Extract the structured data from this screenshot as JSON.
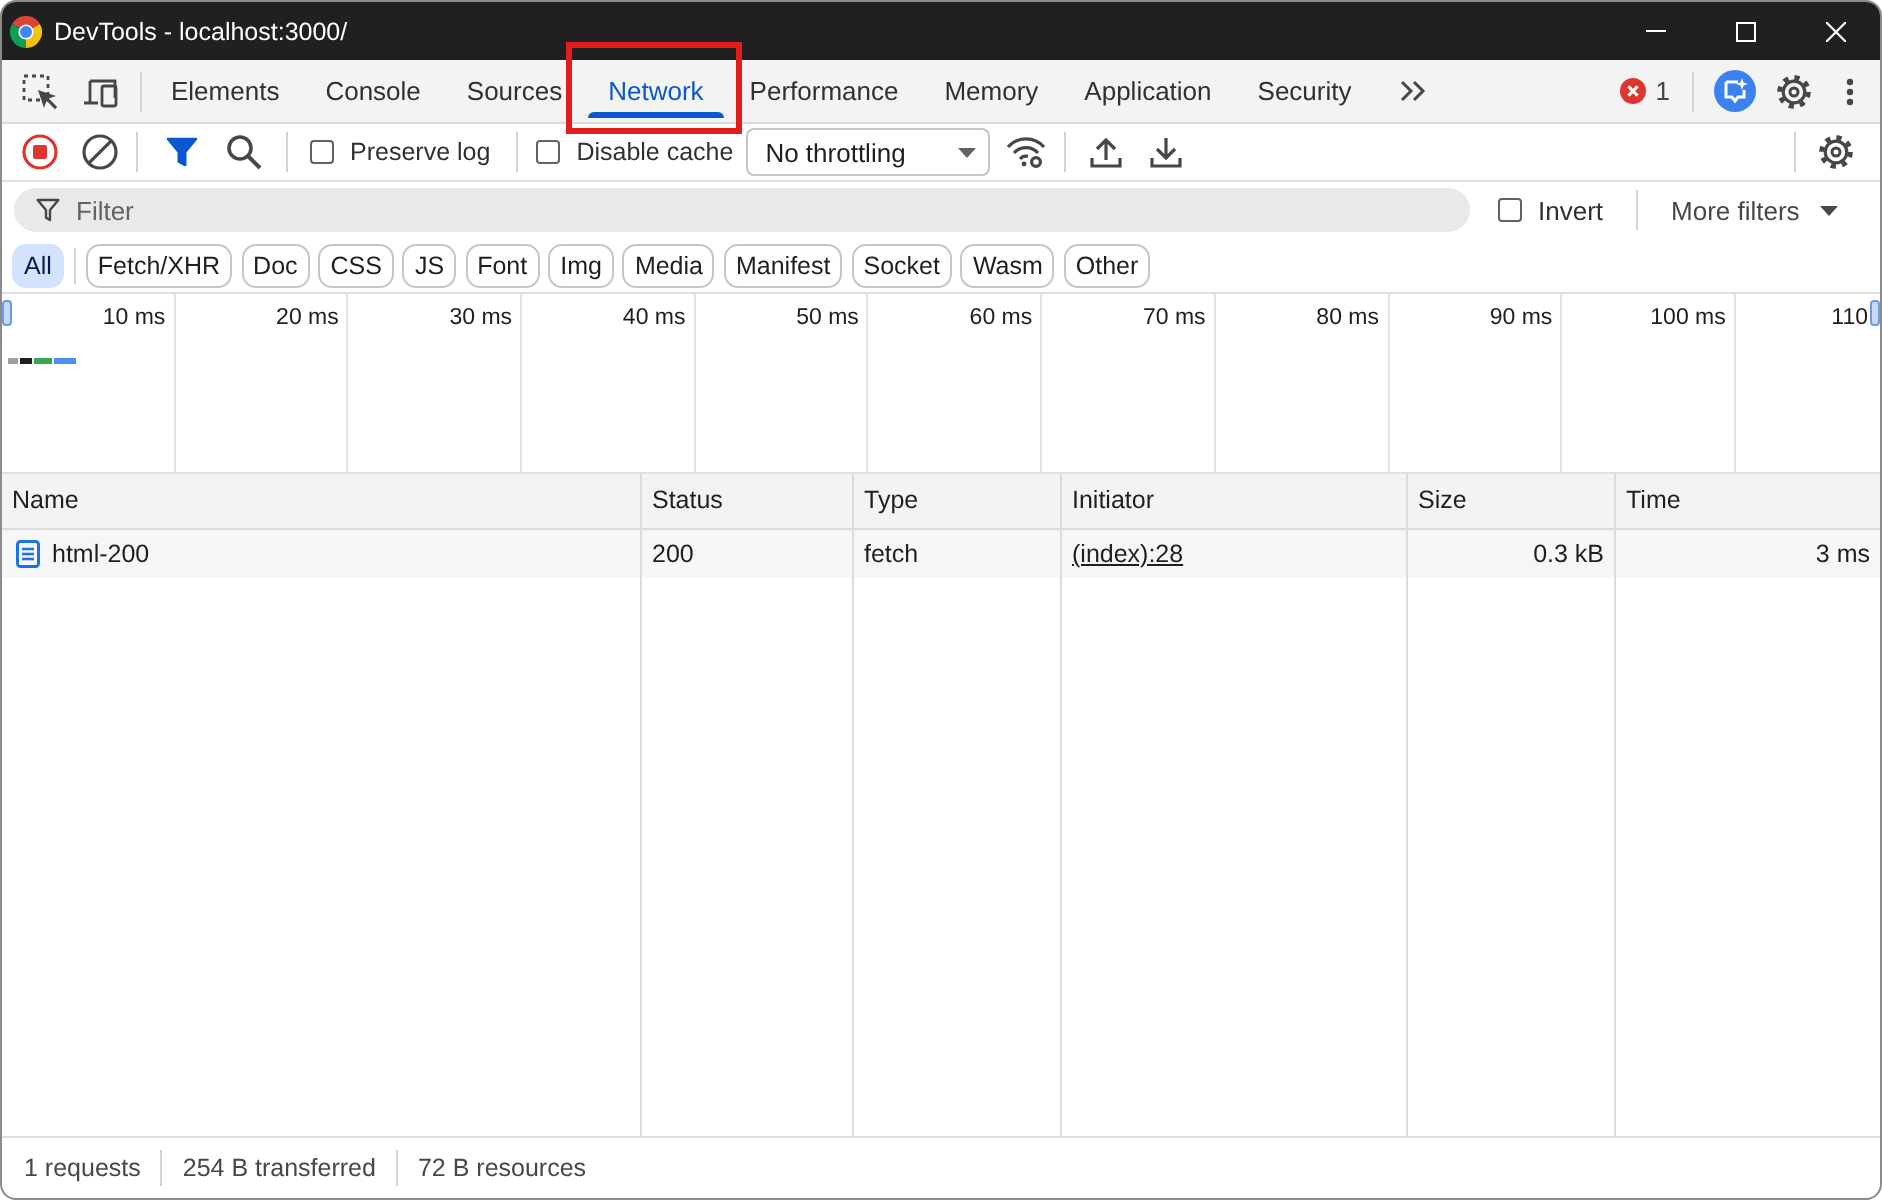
{
  "window": {
    "title": "DevTools - localhost:3000/"
  },
  "tabs": [
    {
      "label": "Elements",
      "selected": false,
      "highlighted": false
    },
    {
      "label": "Console",
      "selected": false,
      "highlighted": false
    },
    {
      "label": "Sources",
      "selected": false,
      "highlighted": false
    },
    {
      "label": "Network",
      "selected": true,
      "highlighted": true
    },
    {
      "label": "Performance",
      "selected": false,
      "highlighted": false
    },
    {
      "label": "Memory",
      "selected": false,
      "highlighted": false
    },
    {
      "label": "Application",
      "selected": false,
      "highlighted": false
    },
    {
      "label": "Security",
      "selected": false,
      "highlighted": false
    }
  ],
  "issues": {
    "error_count": "1"
  },
  "toolbar": {
    "recording": true,
    "filter_active": true,
    "preserve_log": {
      "label": "Preserve log",
      "checked": false
    },
    "disable_cache": {
      "label": "Disable cache",
      "checked": false
    },
    "throttling": "No throttling"
  },
  "filter": {
    "placeholder": "Filter",
    "invert": {
      "label": "Invert",
      "checked": false
    },
    "more_filters": "More filters"
  },
  "type_filters": [
    {
      "label": "All",
      "selected": true
    },
    {
      "label": "Fetch/XHR",
      "selected": false
    },
    {
      "label": "Doc",
      "selected": false
    },
    {
      "label": "CSS",
      "selected": false
    },
    {
      "label": "JS",
      "selected": false
    },
    {
      "label": "Font",
      "selected": false
    },
    {
      "label": "Img",
      "selected": false
    },
    {
      "label": "Media",
      "selected": false
    },
    {
      "label": "Manifest",
      "selected": false
    },
    {
      "label": "Socket",
      "selected": false
    },
    {
      "label": "Wasm",
      "selected": false
    },
    {
      "label": "Other",
      "selected": false
    }
  ],
  "overview": {
    "ticks": [
      "10 ms",
      "20 ms",
      "30 ms",
      "40 ms",
      "50 ms",
      "60 ms",
      "70 ms",
      "80 ms",
      "90 ms",
      "100 ms",
      "110"
    ]
  },
  "table": {
    "columns": [
      "Name",
      "Status",
      "Type",
      "Initiator",
      "Size",
      "Time"
    ],
    "rows": [
      {
        "name": "html-200",
        "status": "200",
        "type": "fetch",
        "initiator": "(index):28",
        "size": "0.3 kB",
        "time": "3 ms"
      }
    ]
  },
  "status_bar": [
    "1 requests",
    "254 B transferred",
    "72 B resources"
  ]
}
